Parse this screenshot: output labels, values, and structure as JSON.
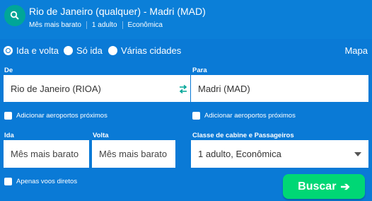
{
  "header": {
    "route_title": "Rio de Janeiro (qualquer) - Madri (MAD)",
    "summary": [
      "Mês mais barato",
      "1 adulto",
      "Econômica"
    ]
  },
  "trip_type": {
    "options": [
      "Ida e volta",
      "Só ida",
      "Várias cidades"
    ],
    "selected": "Ida e volta"
  },
  "map_link": "Mapa",
  "origin": {
    "label": "De",
    "value": "Rio de Janeiro (RIOA)"
  },
  "destination": {
    "label": "Para",
    "value": "Madri (MAD)"
  },
  "nearby_airports_label": "Adicionar aeroportos próximos",
  "depart": {
    "label": "Ida",
    "placeholder": "Mês mais barato"
  },
  "return": {
    "label": "Volta",
    "placeholder": "Mês mais barato"
  },
  "cabin": {
    "label": "Classe de cabine e Passageiros",
    "value": "1 adulto, Econômica"
  },
  "direct_only_label": "Apenas voos diretos",
  "search_button": "Buscar",
  "colors": {
    "background": "#0a7ad6",
    "accent_button": "#00d775",
    "search_circle": "#00a698"
  },
  "icons": {
    "search": "search-icon",
    "swap": "swap-icon",
    "arrow": "arrow-right-icon"
  }
}
